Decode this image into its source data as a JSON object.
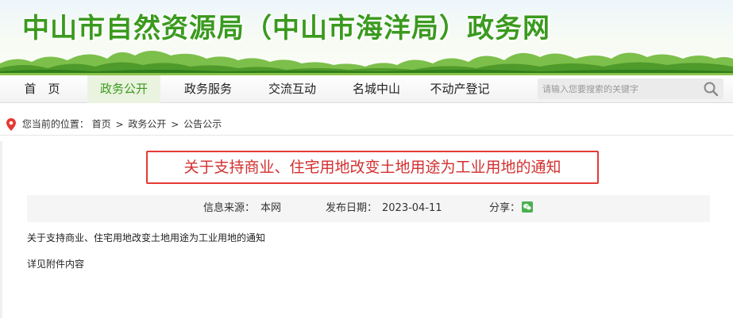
{
  "site": {
    "title": "中山市自然资源局（中山市海洋局）政务网"
  },
  "nav": {
    "items": [
      {
        "label": "首　页",
        "active": false
      },
      {
        "label": "政务公开",
        "active": true
      },
      {
        "label": "政务服务",
        "active": false
      },
      {
        "label": "交流互动",
        "active": false
      },
      {
        "label": "名城中山",
        "active": false
      },
      {
        "label": "不动产登记",
        "active": false
      }
    ],
    "search_placeholder": "请输入您要搜索的关键字"
  },
  "breadcrumb": {
    "prefix": "您当前的位置：",
    "items": [
      "首页",
      "政务公开",
      "公告公示"
    ],
    "separator": ">"
  },
  "article": {
    "title": "关于支持商业、住宅用地改变土地用途为工业用地的通知",
    "source_label": "信息来源：",
    "source_value": "本网",
    "date_label": "发布日期：",
    "date_value": "2023-04-11",
    "share_label": "分享：",
    "body_line1": "关于支持商业、住宅用地改变土地用途为工业用地的通知",
    "body_line2": "详见附件内容"
  },
  "colors": {
    "brand_green": "#3a9a1e",
    "title_red": "#d32f2f",
    "wechat_green": "#4caf50"
  }
}
